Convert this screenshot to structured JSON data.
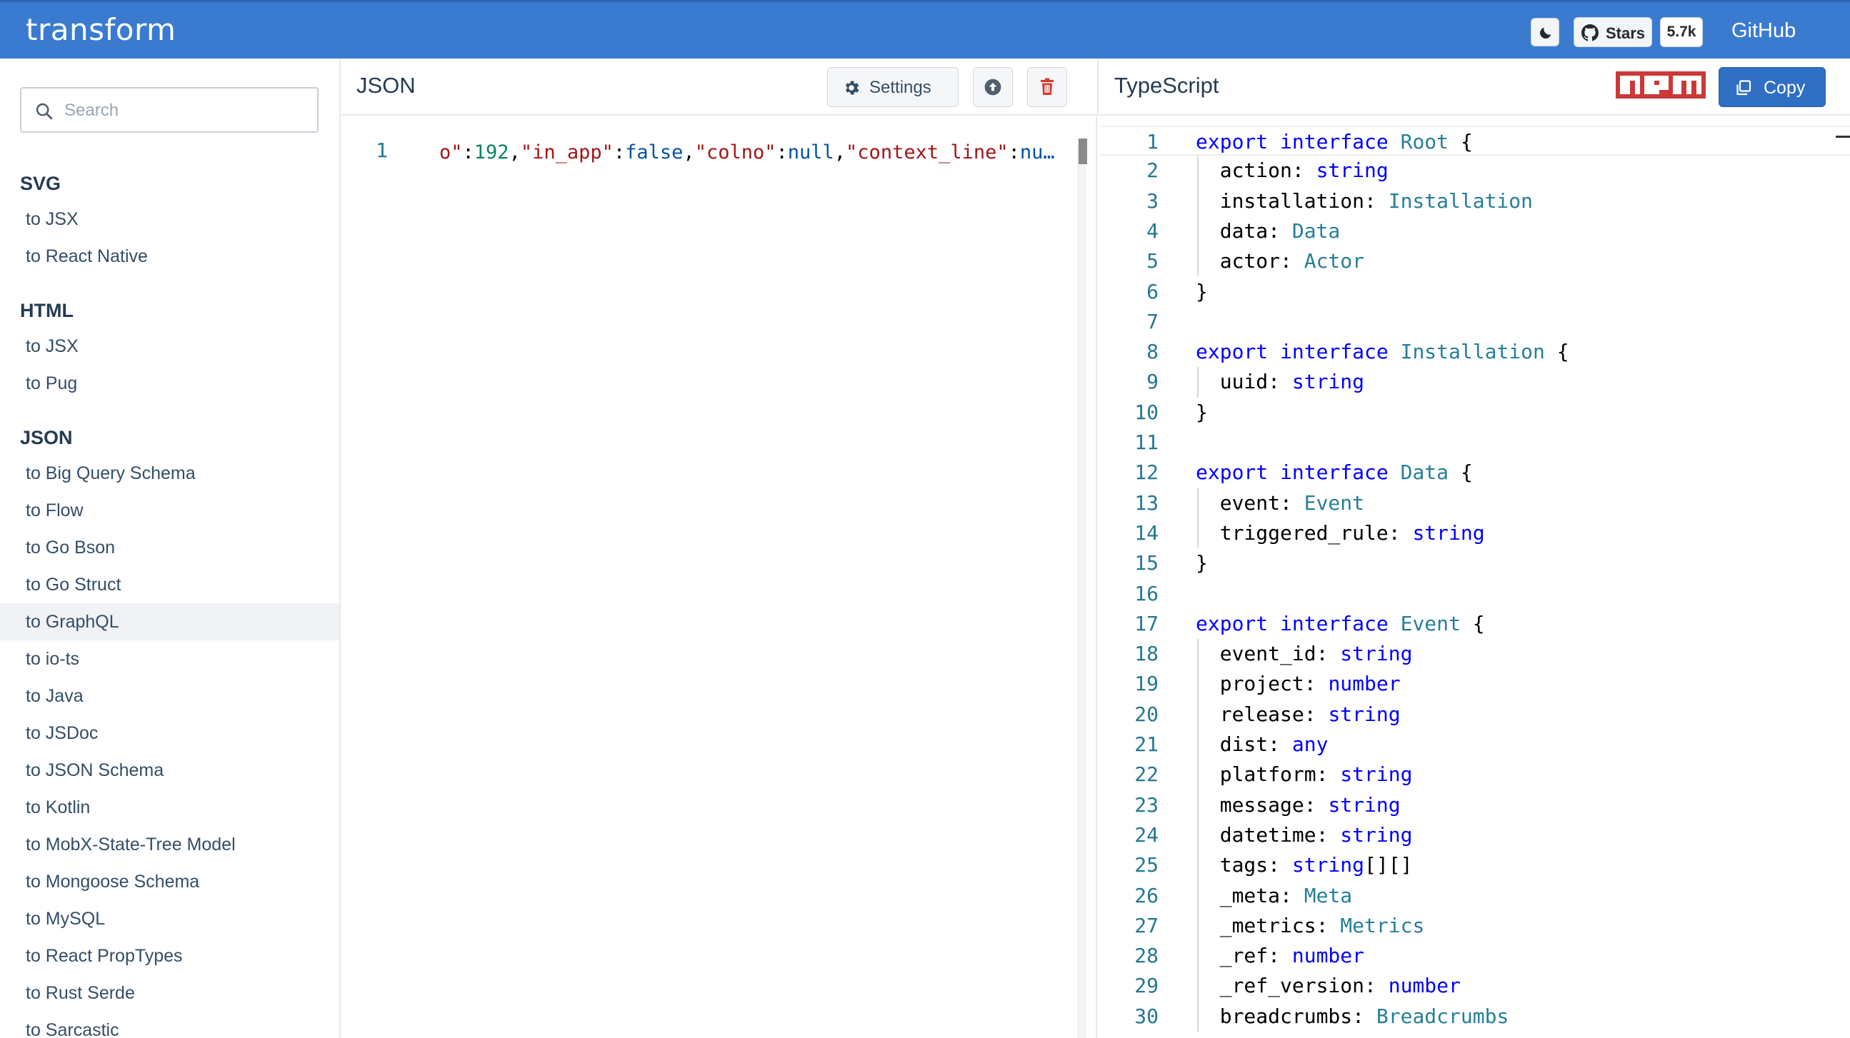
{
  "header": {
    "brand": "transform",
    "theme_toggle_icon": "moon-icon",
    "stars_label": "Stars",
    "stars_count": "5.7k",
    "github_label": "GitHub"
  },
  "sidebar": {
    "search_placeholder": "Search",
    "categories": [
      {
        "title": "SVG",
        "items": [
          "to JSX",
          "to React Native"
        ]
      },
      {
        "title": "HTML",
        "items": [
          "to JSX",
          "to Pug"
        ]
      },
      {
        "title": "JSON",
        "items": [
          "to Big Query Schema",
          "to Flow",
          "to Go Bson",
          "to Go Struct",
          "to GraphQL",
          "to io-ts",
          "to Java",
          "to JSDoc",
          "to JSON Schema",
          "to Kotlin",
          "to MobX-State-Tree Model",
          "to Mongoose Schema",
          "to MySQL",
          "to React PropTypes",
          "to Rust Serde",
          "to Sarcastic"
        ]
      }
    ],
    "active_item": "to GraphQL"
  },
  "json_panel": {
    "title": "JSON",
    "settings_label": "Settings",
    "upload_icon": "upload-icon",
    "delete_icon": "trash-icon",
    "line_number": "1",
    "tokens": [
      {
        "t": "o\"",
        "c": "key"
      },
      {
        "t": ":",
        "c": "pun"
      },
      {
        "t": "192",
        "c": "num"
      },
      {
        "t": ",",
        "c": "pun"
      },
      {
        "t": "\"in_app\"",
        "c": "key"
      },
      {
        "t": ":",
        "c": "pun"
      },
      {
        "t": "false",
        "c": "bool"
      },
      {
        "t": ",",
        "c": "pun"
      },
      {
        "t": "\"colno\"",
        "c": "key"
      },
      {
        "t": ":",
        "c": "pun"
      },
      {
        "t": "null",
        "c": "bool"
      },
      {
        "t": ",",
        "c": "pun"
      },
      {
        "t": "\"context_line\"",
        "c": "key"
      },
      {
        "t": ":",
        "c": "pun"
      },
      {
        "t": "nu…",
        "c": "bool"
      }
    ]
  },
  "ts_panel": {
    "title": "TypeScript",
    "npm_label": "npm",
    "copy_label": "Copy",
    "lines": [
      [
        [
          "export",
          "kw"
        ],
        [
          " ",
          "plain"
        ],
        [
          "interface",
          "kw"
        ],
        [
          " ",
          "plain"
        ],
        [
          "Root",
          "type"
        ],
        [
          " {",
          "plain"
        ]
      ],
      [
        [
          "  action: ",
          "plain"
        ],
        [
          "string",
          "prim"
        ]
      ],
      [
        [
          "  installation: ",
          "plain"
        ],
        [
          "Installation",
          "type"
        ]
      ],
      [
        [
          "  data: ",
          "plain"
        ],
        [
          "Data",
          "type"
        ]
      ],
      [
        [
          "  actor: ",
          "plain"
        ],
        [
          "Actor",
          "type"
        ]
      ],
      [
        [
          "}",
          "plain"
        ]
      ],
      [],
      [
        [
          "export",
          "kw"
        ],
        [
          " ",
          "plain"
        ],
        [
          "interface",
          "kw"
        ],
        [
          " ",
          "plain"
        ],
        [
          "Installation",
          "type"
        ],
        [
          " {",
          "plain"
        ]
      ],
      [
        [
          "  uuid: ",
          "plain"
        ],
        [
          "string",
          "prim"
        ]
      ],
      [
        [
          "}",
          "plain"
        ]
      ],
      [],
      [
        [
          "export",
          "kw"
        ],
        [
          " ",
          "plain"
        ],
        [
          "interface",
          "kw"
        ],
        [
          " ",
          "plain"
        ],
        [
          "Data",
          "type"
        ],
        [
          " {",
          "plain"
        ]
      ],
      [
        [
          "  event: ",
          "plain"
        ],
        [
          "Event",
          "type"
        ]
      ],
      [
        [
          "  triggered_rule: ",
          "plain"
        ],
        [
          "string",
          "prim"
        ]
      ],
      [
        [
          "}",
          "plain"
        ]
      ],
      [],
      [
        [
          "export",
          "kw"
        ],
        [
          " ",
          "plain"
        ],
        [
          "interface",
          "kw"
        ],
        [
          " ",
          "plain"
        ],
        [
          "Event",
          "type"
        ],
        [
          " {",
          "plain"
        ]
      ],
      [
        [
          "  event_id: ",
          "plain"
        ],
        [
          "string",
          "prim"
        ]
      ],
      [
        [
          "  project: ",
          "plain"
        ],
        [
          "number",
          "prim"
        ]
      ],
      [
        [
          "  release: ",
          "plain"
        ],
        [
          "string",
          "prim"
        ]
      ],
      [
        [
          "  dist: ",
          "plain"
        ],
        [
          "any",
          "prim"
        ]
      ],
      [
        [
          "  platform: ",
          "plain"
        ],
        [
          "string",
          "prim"
        ]
      ],
      [
        [
          "  message: ",
          "plain"
        ],
        [
          "string",
          "prim"
        ]
      ],
      [
        [
          "  datetime: ",
          "plain"
        ],
        [
          "string",
          "prim"
        ]
      ],
      [
        [
          "  tags: ",
          "plain"
        ],
        [
          "string",
          "prim"
        ],
        [
          "[][]",
          "plain"
        ]
      ],
      [
        [
          "  _meta: ",
          "plain"
        ],
        [
          "Meta",
          "type"
        ]
      ],
      [
        [
          "  _metrics: ",
          "plain"
        ],
        [
          "Metrics",
          "type"
        ]
      ],
      [
        [
          "  _ref: ",
          "plain"
        ],
        [
          "number",
          "prim"
        ]
      ],
      [
        [
          "  _ref_version: ",
          "plain"
        ],
        [
          "number",
          "prim"
        ]
      ],
      [
        [
          "  breadcrumbs: ",
          "plain"
        ],
        [
          "Breadcrumbs",
          "type"
        ]
      ]
    ]
  },
  "colors": {
    "header_bg": "#3a7bd0",
    "copy_bg": "#2f6fc4",
    "npm_red": "#cb3837",
    "delete_red": "#d33a2c"
  }
}
